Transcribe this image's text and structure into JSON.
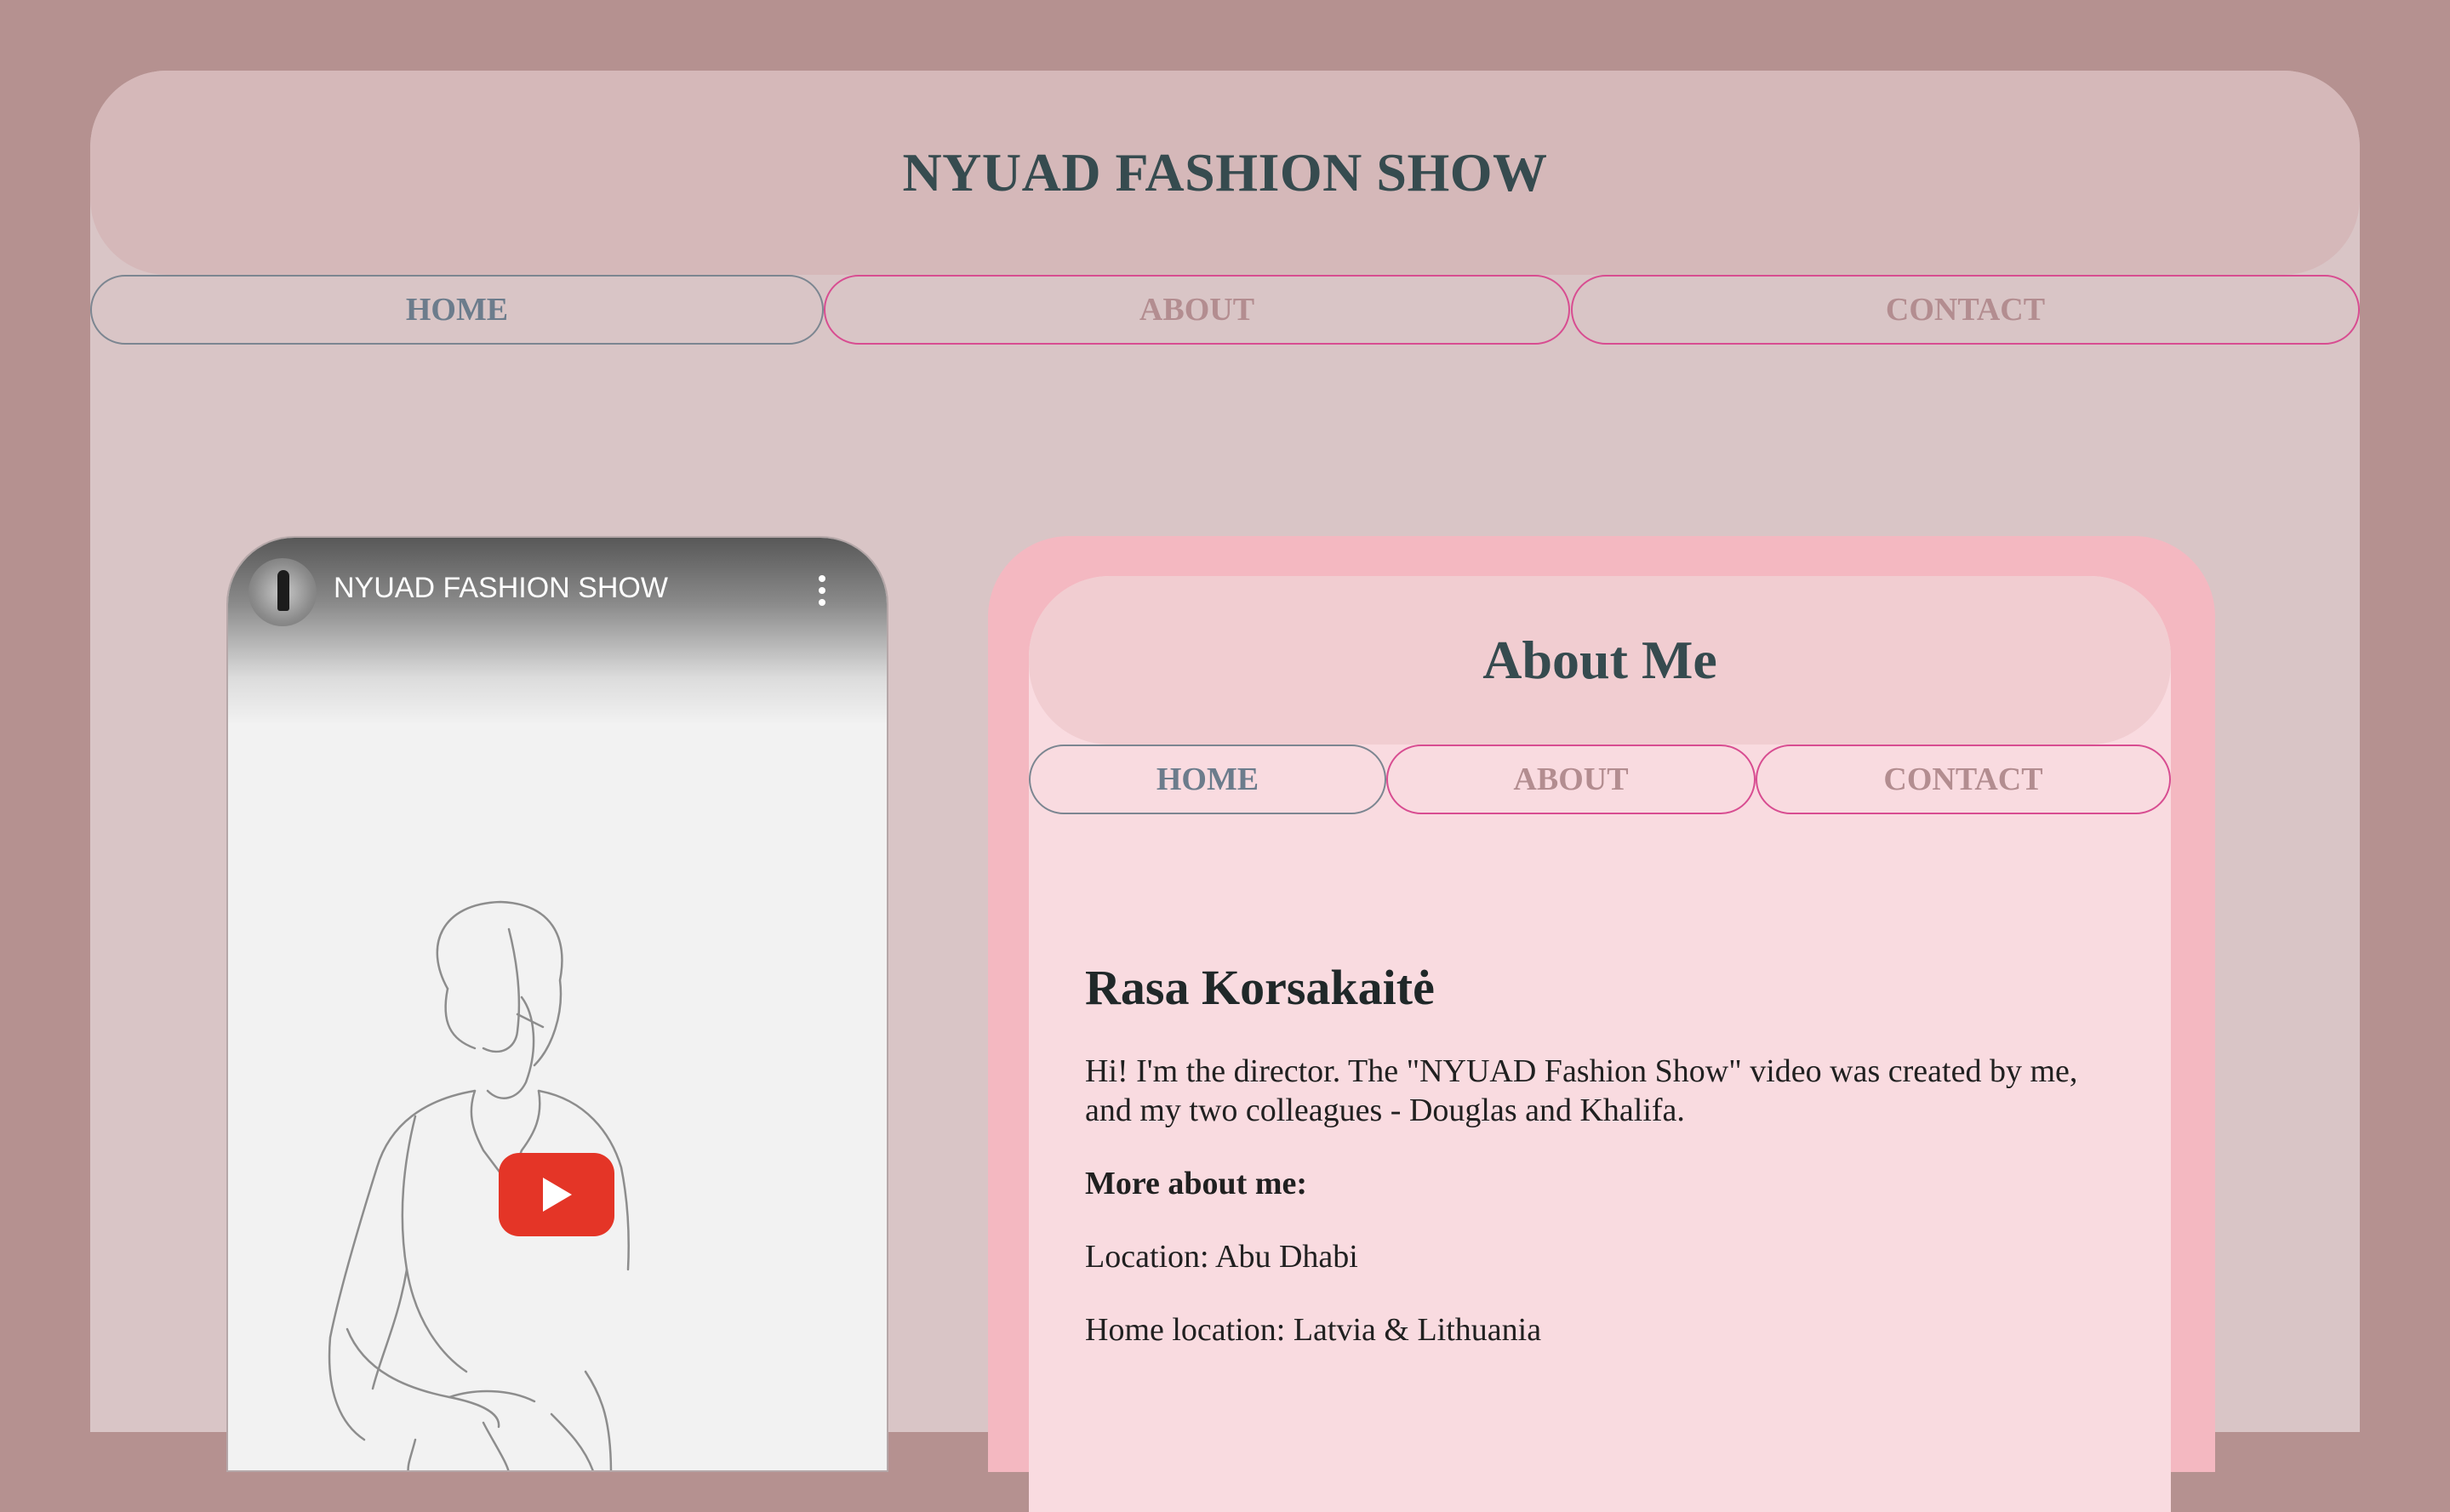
{
  "site": {
    "title": "NYUAD FASHION SHOW"
  },
  "nav": {
    "items": [
      {
        "label": "HOME",
        "active": true
      },
      {
        "label": "ABOUT",
        "active": false
      },
      {
        "label": "CONTACT",
        "active": false
      }
    ]
  },
  "video": {
    "title": "NYUAD FASHION SHOW",
    "channel_avatar_icon": "channel-avatar",
    "menu_icon": "more-vertical-icon",
    "play_icon": "youtube-play-icon"
  },
  "about": {
    "title": "About Me",
    "nav": [
      {
        "label": "HOME",
        "active": true
      },
      {
        "label": "ABOUT",
        "active": false
      },
      {
        "label": "CONTACT",
        "active": false
      }
    ],
    "name": "Rasa Korsakaitė",
    "intro": "Hi! I'm the director. The \"NYUAD Fashion Show\" video was created by me, and my two colleagues - Douglas and Khalifa.",
    "more_heading": "More about me:",
    "location": "Location: Abu Dhabi",
    "home_location": "Home location: Latvia & Lithuania"
  },
  "colors": {
    "background": "#b59190",
    "page": "#d9c5c6",
    "header": "#d5b8b9",
    "nav_border": "#d84d91",
    "card_outer": "#f4b8c1",
    "card_inner": "#f9dbe0",
    "title_text": "#364b4f",
    "play_red": "#e43527"
  }
}
